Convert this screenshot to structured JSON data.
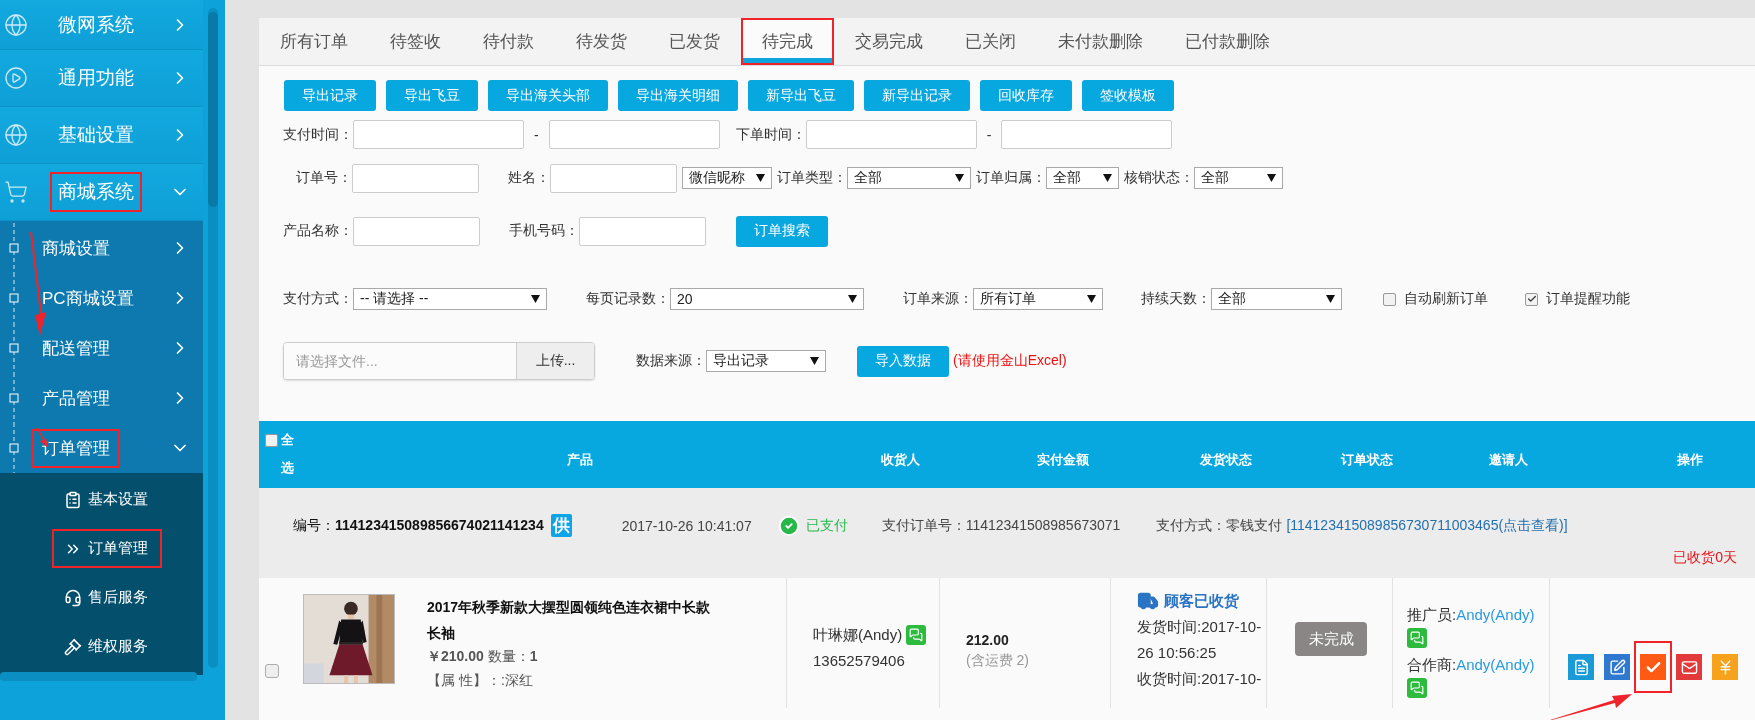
{
  "sidebar": {
    "items": [
      {
        "label": "微网系统",
        "expanded": false,
        "highlighted": false
      },
      {
        "label": "通用功能",
        "expanded": false,
        "highlighted": false
      },
      {
        "label": "基础设置",
        "expanded": false,
        "highlighted": false
      },
      {
        "label": "商城系统",
        "expanded": true,
        "highlighted": true,
        "children": [
          {
            "label": "商城设置",
            "expanded": false,
            "highlighted": false
          },
          {
            "label": "PC商城设置",
            "expanded": false,
            "highlighted": false
          },
          {
            "label": "配送管理",
            "expanded": false,
            "highlighted": false
          },
          {
            "label": "产品管理",
            "expanded": false,
            "highlighted": false
          },
          {
            "label": "订单管理",
            "expanded": true,
            "highlighted": true,
            "children": [
              {
                "label": "基本设置",
                "highlighted": false
              },
              {
                "label": "订单管理",
                "highlighted": true
              },
              {
                "label": "售后服务",
                "highlighted": false
              },
              {
                "label": "维权服务",
                "highlighted": false
              }
            ]
          }
        ]
      }
    ]
  },
  "tabs": [
    {
      "label": "所有订单",
      "selected": false
    },
    {
      "label": "待签收",
      "selected": false
    },
    {
      "label": "待付款",
      "selected": false
    },
    {
      "label": "待发货",
      "selected": false
    },
    {
      "label": "已发货",
      "selected": false
    },
    {
      "label": "待完成",
      "selected": true
    },
    {
      "label": "交易完成",
      "selected": false
    },
    {
      "label": "已关闭",
      "selected": false
    },
    {
      "label": "未付款删除",
      "selected": false
    },
    {
      "label": "已付款删除",
      "selected": false
    }
  ],
  "toolbar_buttons": [
    "导出记录",
    "导出飞豆",
    "导出海关头部",
    "导出海关明细",
    "新导出飞豆",
    "新导出记录",
    "回收库存",
    "签收模板"
  ],
  "filter_rows": [
    [
      {
        "kind": "range",
        "label": "支付时间：",
        "separator": "-"
      },
      {
        "kind": "range",
        "label": "下单时间：",
        "separator": "-"
      }
    ],
    [
      {
        "kind": "text",
        "label": "订单号："
      },
      {
        "kind": "text",
        "label": "姓名："
      },
      {
        "kind": "select",
        "value": "微信昵称"
      },
      {
        "kind": "select",
        "label": "订单类型：",
        "value": "全部"
      },
      {
        "kind": "select",
        "label": "订单归属：",
        "value": "全部"
      },
      {
        "kind": "select",
        "label": "核销状态：",
        "value": "全部"
      }
    ],
    [
      {
        "kind": "text",
        "label": "产品名称："
      },
      {
        "kind": "text",
        "label": "手机号码："
      },
      {
        "kind": "button",
        "label": "订单搜索"
      }
    ],
    [
      {
        "kind": "select",
        "label": "支付方式：",
        "value": "-- 请选择 --"
      },
      {
        "kind": "select",
        "label": "每页记录数：",
        "value": "20"
      },
      {
        "kind": "select",
        "label": "订单来源：",
        "value": "所有订单"
      },
      {
        "kind": "select",
        "label": "持续天数：",
        "value": "全部"
      },
      {
        "kind": "checkbox",
        "label": "自动刷新订单",
        "checked": false
      },
      {
        "kind": "checkbox",
        "label": "订单提醒功能",
        "checked": true
      }
    ],
    [
      {
        "kind": "file",
        "placeholder": "请选择文件...",
        "button": "上传..."
      },
      {
        "kind": "select",
        "label": "数据来源：",
        "value": "导出记录"
      },
      {
        "kind": "button",
        "label": "导入数据"
      },
      {
        "kind": "note",
        "label": "(请使用金山Excel)"
      }
    ]
  ],
  "table": {
    "select_all": {
      "label": "全选",
      "checked": false
    },
    "columns": [
      "产品",
      "收货人",
      "实付金额",
      "发货状态",
      "订单状态",
      "邀请人",
      "操作"
    ],
    "orders": [
      {
        "number": "编号：**114123415089856674021141234**",
        "badge": "供",
        "time": "2017-10-26 10:41:07",
        "paid_status": "已支付",
        "pay_order_no": "支付订单号：11412341508985673071",
        "pay_method": "支付方式：零钱支付",
        "pay_link": "[114123415089856730711003465(点击查看)]",
        "received_days": "已收货0天",
        "selected": false,
        "product": {
          "kind": "picture",
          "title": "2017年秋季新款大摆型圆领纯色连衣裙中长款长袖",
          "price": "**￥210.00** 数量：**1**",
          "attributes": "【属 性】：:深红"
        },
        "receiver": {
          "name": "叶琳娜(Andy)",
          "phone": "13652579406"
        },
        "amount": {
          "total": "212.00",
          "shipping": "(含运费 2)"
        },
        "shipping_status": {
          "label": "顾客已收货",
          "shipped_at": "发货时间:2017-10-26 10:56:25",
          "received_at": "收货时间:2017-10-"
        },
        "order_status": "未完成",
        "inviters": [
          {
            "role": "推广员:",
            "name": "Andy(Andy)"
          },
          {
            "role": "合作商:",
            "name": "Andy(Andy)"
          }
        ],
        "actions": [
          {
            "kind": "view",
            "highlighted": false
          },
          {
            "kind": "edit",
            "highlighted": false
          },
          {
            "kind": "complete",
            "highlighted": true
          },
          {
            "kind": "mail",
            "highlighted": false
          },
          {
            "kind": "price",
            "highlighted": false
          }
        ]
      }
    ]
  }
}
